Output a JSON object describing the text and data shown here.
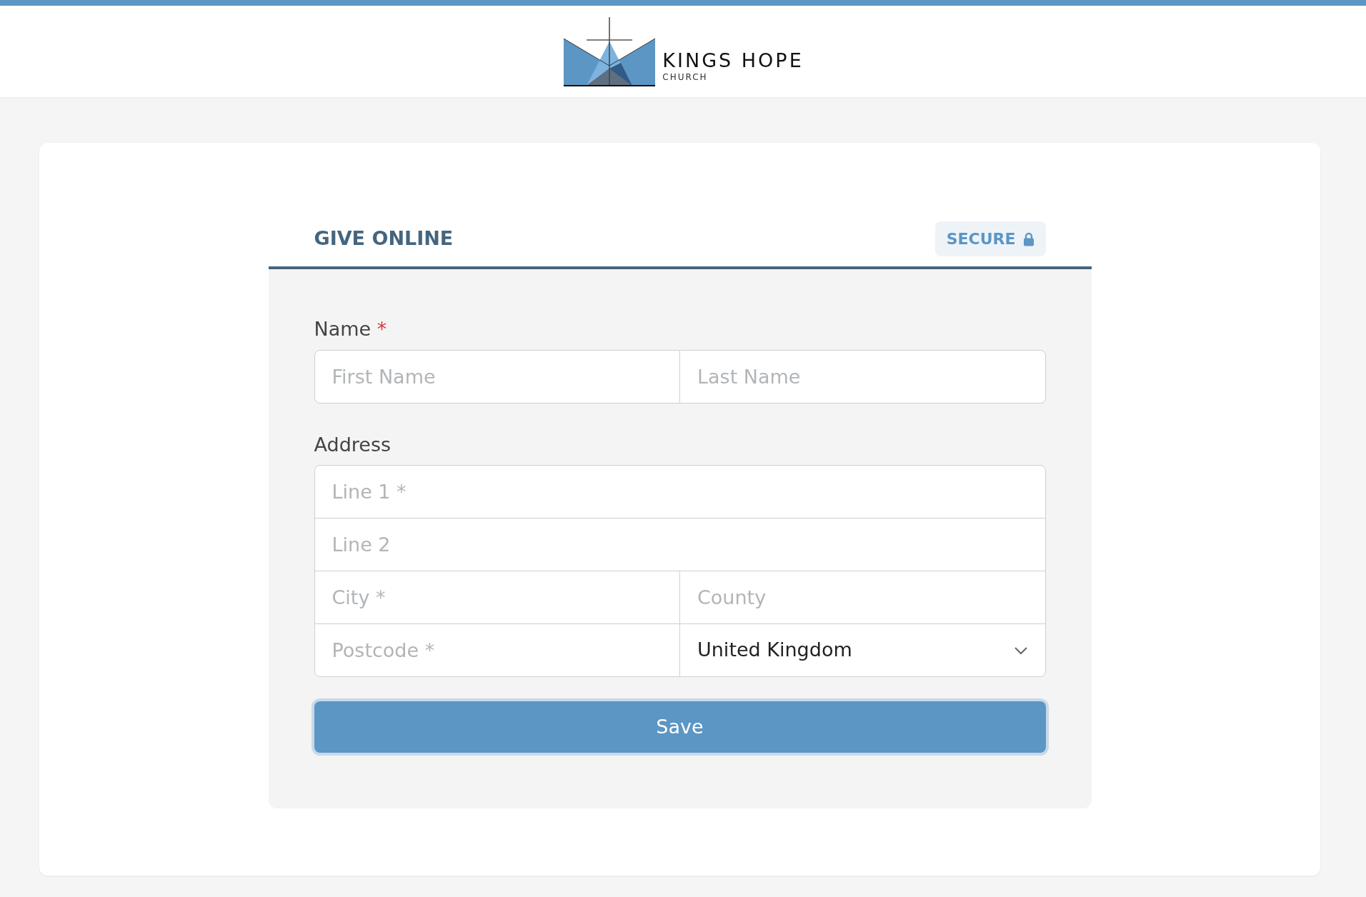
{
  "header": {
    "logo": {
      "title": "KINGS HOPE",
      "subtitle": "CHURCH"
    }
  },
  "form": {
    "title": "GIVE ONLINE",
    "badge": "SECURE",
    "groups": [
      {
        "label": "Name",
        "required_mark": "*",
        "rows": [
          [
            {
              "kind": "text",
              "placeholder": "First Name"
            },
            {
              "kind": "text",
              "placeholder": "Last Name"
            }
          ]
        ]
      },
      {
        "label": "Address",
        "rows": [
          [
            {
              "kind": "text",
              "placeholder": "Line 1 *"
            }
          ],
          [
            {
              "kind": "text",
              "placeholder": "Line 2"
            }
          ],
          [
            {
              "kind": "text",
              "placeholder": "City *"
            },
            {
              "kind": "text",
              "placeholder": "County"
            }
          ],
          [
            {
              "kind": "text",
              "placeholder": "Postcode *"
            },
            {
              "kind": "select",
              "value": "United Kingdom"
            }
          ]
        ]
      }
    ],
    "submit": "Save"
  }
}
